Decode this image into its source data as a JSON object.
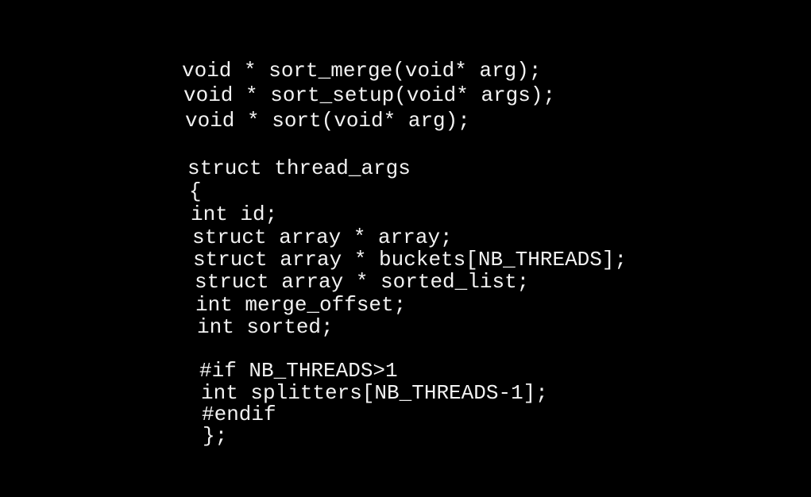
{
  "code": {
    "lines": [
      "void * sort_merge(void* arg);",
      "void * sort_setup(void* args);",
      "void * sort(void* arg);",
      "struct thread_args",
      "{",
      "int id;",
      "struct array * array;",
      "struct array * buckets[NB_THREADS];",
      "struct array * sorted_list;",
      "int merge_offset;",
      "int sorted;",
      "#if NB_THREADS>1",
      "int splitters[NB_THREADS-1];",
      "#endif",
      "};"
    ]
  },
  "colors": {
    "background": "#000000",
    "text": "#f2f2f2"
  }
}
